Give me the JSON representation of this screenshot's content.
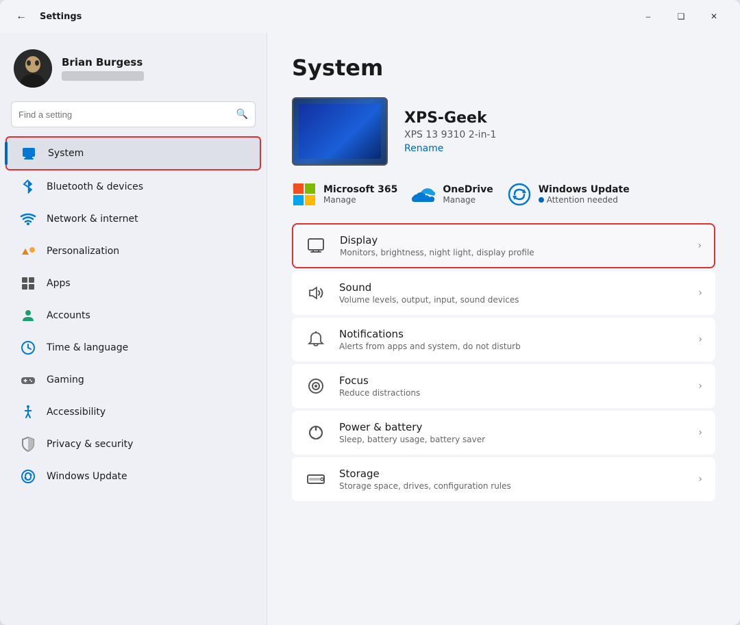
{
  "window": {
    "title": "Settings",
    "controls": {
      "minimize": "–",
      "maximize": "❑",
      "close": "✕"
    }
  },
  "sidebar": {
    "user": {
      "name": "Brian Burgess",
      "avatar_alt": "User avatar"
    },
    "search": {
      "placeholder": "Find a setting"
    },
    "nav_items": [
      {
        "id": "system",
        "label": "System",
        "icon": "🖥",
        "active": true
      },
      {
        "id": "bluetooth",
        "label": "Bluetooth & devices",
        "icon": "🔵",
        "active": false
      },
      {
        "id": "network",
        "label": "Network & internet",
        "icon": "📶",
        "active": false
      },
      {
        "id": "personalization",
        "label": "Personalization",
        "icon": "🖌",
        "active": false
      },
      {
        "id": "apps",
        "label": "Apps",
        "icon": "📦",
        "active": false
      },
      {
        "id": "accounts",
        "label": "Accounts",
        "icon": "👤",
        "active": false
      },
      {
        "id": "time",
        "label": "Time & language",
        "icon": "🕐",
        "active": false
      },
      {
        "id": "gaming",
        "label": "Gaming",
        "icon": "🎮",
        "active": false
      },
      {
        "id": "accessibility",
        "label": "Accessibility",
        "icon": "♿",
        "active": false
      },
      {
        "id": "privacy",
        "label": "Privacy & security",
        "icon": "🛡",
        "active": false
      },
      {
        "id": "windows-update",
        "label": "Windows Update",
        "icon": "🔄",
        "active": false
      }
    ]
  },
  "main": {
    "title": "System",
    "device": {
      "name": "XPS-Geek",
      "model": "XPS 13 9310 2-in-1",
      "rename_label": "Rename"
    },
    "quick_links": [
      {
        "id": "ms365",
        "name": "Microsoft 365",
        "sub": "Manage",
        "alert": false
      },
      {
        "id": "onedrive",
        "name": "OneDrive",
        "sub": "Manage",
        "alert": false
      },
      {
        "id": "windows-update",
        "name": "Windows Update",
        "sub": "Attention needed",
        "alert": true
      }
    ],
    "settings": [
      {
        "id": "display",
        "name": "Display",
        "desc": "Monitors, brightness, night light, display profile",
        "highlighted": true
      },
      {
        "id": "sound",
        "name": "Sound",
        "desc": "Volume levels, output, input, sound devices",
        "highlighted": false
      },
      {
        "id": "notifications",
        "name": "Notifications",
        "desc": "Alerts from apps and system, do not disturb",
        "highlighted": false
      },
      {
        "id": "focus",
        "name": "Focus",
        "desc": "Reduce distractions",
        "highlighted": false
      },
      {
        "id": "power",
        "name": "Power & battery",
        "desc": "Sleep, battery usage, battery saver",
        "highlighted": false
      },
      {
        "id": "storage",
        "name": "Storage",
        "desc": "Storage space, drives, configuration rules",
        "highlighted": false
      }
    ]
  }
}
